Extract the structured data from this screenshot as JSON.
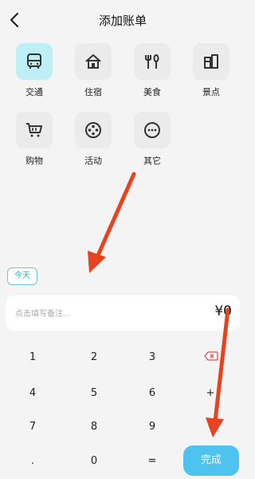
{
  "header": {
    "title": "添加账单"
  },
  "categories": [
    {
      "label": "交通",
      "icon": "bus-icon"
    },
    {
      "label": "住宿",
      "icon": "house-icon"
    },
    {
      "label": "美食",
      "icon": "fork-spoon-icon"
    },
    {
      "label": "景点",
      "icon": "scenery-icon"
    },
    {
      "label": "购物",
      "icon": "shopping-cart-icon"
    },
    {
      "label": "活动",
      "icon": "film-reel-icon"
    },
    {
      "label": "其它",
      "icon": "more-dots-icon"
    }
  ],
  "date_chip": "今天",
  "note": {
    "placeholder": "点击填写备注...",
    "amount": "¥0"
  },
  "keypad": {
    "k1": "1",
    "k2": "2",
    "k3": "3",
    "k4": "4",
    "k5": "5",
    "k6": "6",
    "k7": "7",
    "k8": "8",
    "k9": "9",
    "dot": ".",
    "k0": "0",
    "equals": "=",
    "plus": "+",
    "minus": "-",
    "done": "完成"
  },
  "colors": {
    "accent": "#4ec3f0",
    "selected_bg": "#bfeff6",
    "arrow": "#e8431f"
  }
}
